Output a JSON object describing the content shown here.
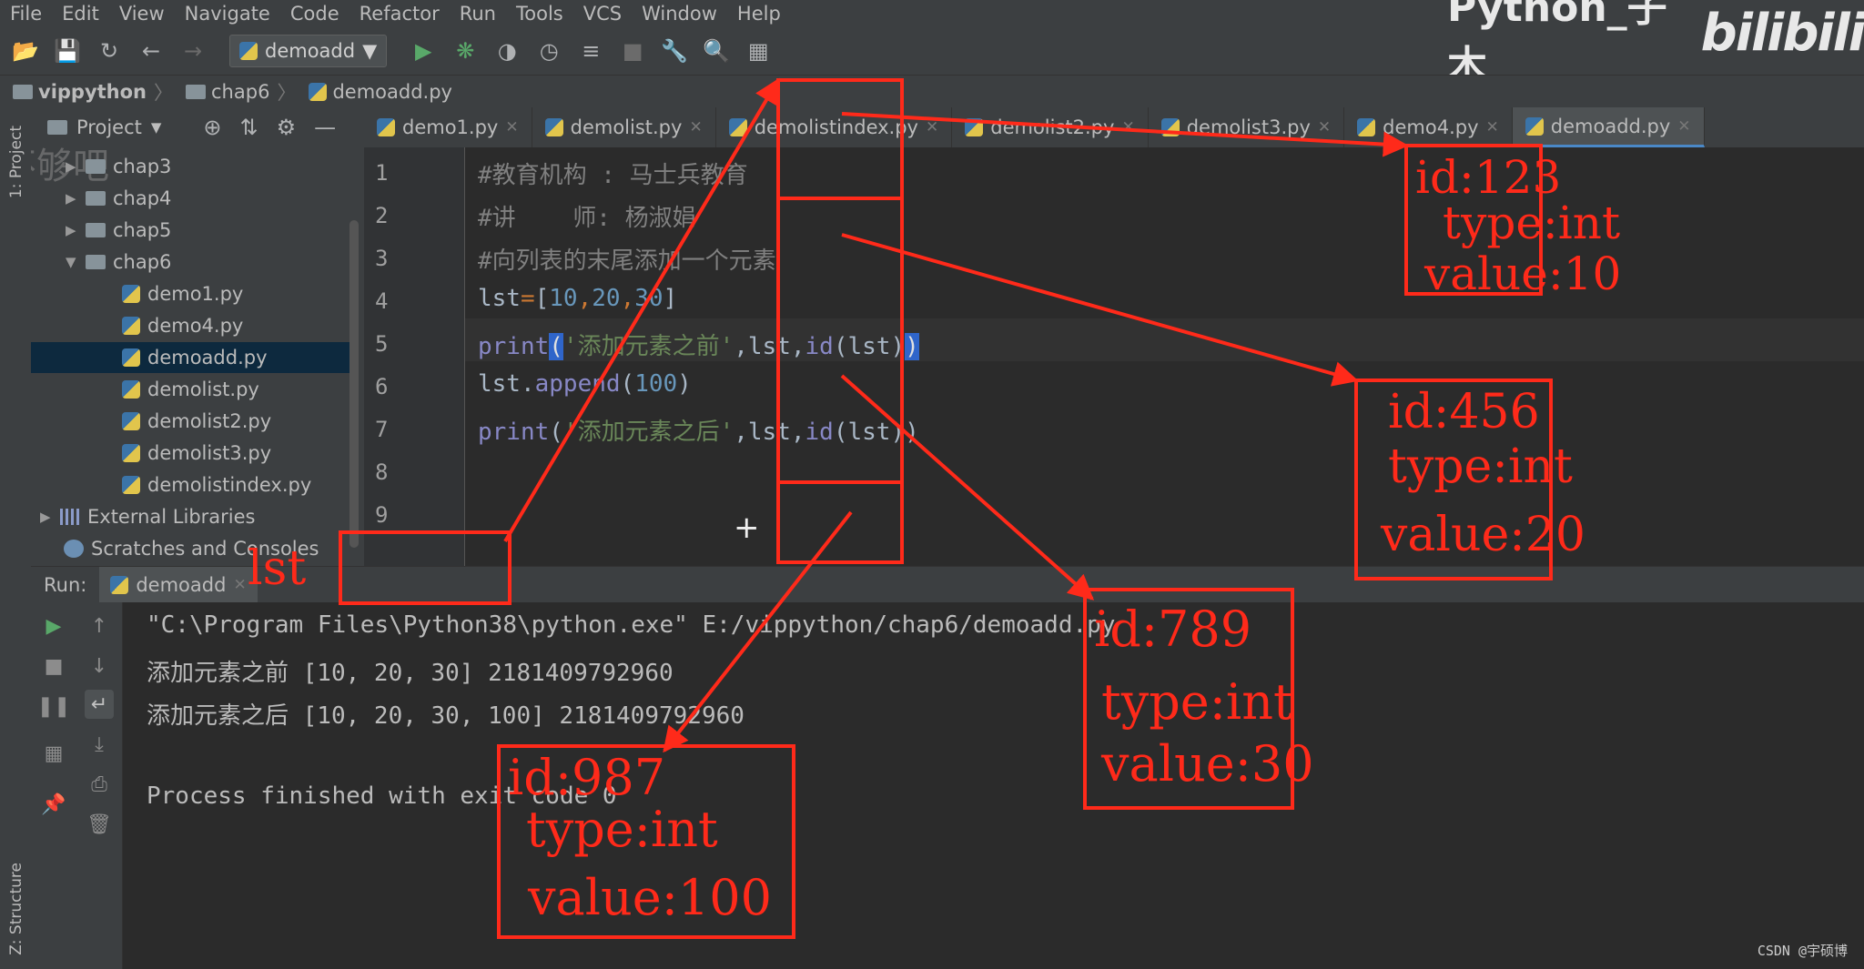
{
  "menu": [
    "File",
    "Edit",
    "View",
    "Navigate",
    "Code",
    "Refactor",
    "Run",
    "Tools",
    "VCS",
    "Window",
    "Help"
  ],
  "watermark": {
    "channel": "Python_子木",
    "logo": "bilibili"
  },
  "toolbar": {
    "run_config": "demoadd"
  },
  "breadcrumb": [
    "vippython",
    "chap6",
    "demoadd.py"
  ],
  "sidebar": {
    "project_label": "1: Project",
    "structure_label": "Z: Structure"
  },
  "project": {
    "header": "Project",
    "overlay": "不够吧",
    "tree": [
      {
        "label": "chap3",
        "type": "folder",
        "expanded": false
      },
      {
        "label": "chap4",
        "type": "folder",
        "expanded": false
      },
      {
        "label": "chap5",
        "type": "folder",
        "expanded": false
      },
      {
        "label": "chap6",
        "type": "folder",
        "expanded": true
      },
      {
        "label": "demo1.py",
        "type": "py"
      },
      {
        "label": "demo4.py",
        "type": "py"
      },
      {
        "label": "demoadd.py",
        "type": "py",
        "selected": true
      },
      {
        "label": "demolist.py",
        "type": "py"
      },
      {
        "label": "demolist2.py",
        "type": "py"
      },
      {
        "label": "demolist3.py",
        "type": "py"
      },
      {
        "label": "demolistindex.py",
        "type": "py"
      },
      {
        "label": "External Libraries",
        "type": "lib"
      },
      {
        "label": "Scratches and Consoles",
        "type": "scratch"
      }
    ]
  },
  "tabs": [
    {
      "label": "demo1.py"
    },
    {
      "label": "demolist.py"
    },
    {
      "label": "demolistindex.py"
    },
    {
      "label": "demolist2.py"
    },
    {
      "label": "demolist3.py"
    },
    {
      "label": "demo4.py"
    },
    {
      "label": "demoadd.py",
      "active": true
    }
  ],
  "editor": {
    "line_numbers": [
      "1",
      "2",
      "3",
      "4",
      "5",
      "6",
      "7",
      "8",
      "9"
    ],
    "line1": "#教育机构 : 马士兵教育",
    "line2": "#讲    师: 杨淑娟",
    "line3": "#向列表的末尾添加一个元素",
    "line4": {
      "a": "lst",
      "b": "=",
      "c": "[",
      "d": "10",
      "e": ",",
      "f": "20",
      "g": ",",
      "h": "30",
      "i": "]"
    },
    "line5": {
      "fn": "print",
      "open": "(",
      "str": "'添加元素之前'",
      "sep": ",lst,",
      "fn2": "id",
      "inner": "(lst)",
      "close": ")"
    },
    "line6": {
      "a": "lst.",
      "b": "append",
      "c": "(",
      "d": "100",
      "e": ")"
    },
    "line7": {
      "fn": "print",
      "open": "(",
      "str": "'添加元素之后'",
      "sep": ",lst,",
      "fn2": "id",
      "inner": "(lst))"
    }
  },
  "run": {
    "label": "Run:",
    "tab": "demoadd",
    "lines": [
      "\"C:\\Program Files\\Python38\\python.exe\" E:/vippython/chap6/demoadd.py",
      "添加元素之前 [10, 20, 30] 2181409792960",
      "添加元素之后 [10, 20, 30, 100] 2181409792960",
      "",
      "Process finished with exit code 0"
    ]
  },
  "annotations": {
    "lst_label": "lst",
    "objects": [
      {
        "id": "id:123",
        "type": "type:int",
        "value": "value:10"
      },
      {
        "id": "id:456",
        "type": "type:int",
        "value": "value:20"
      },
      {
        "id": "id:789",
        "type": "type:int",
        "value": "value:30"
      },
      {
        "id": "id:987",
        "type": "type:int",
        "value": "value:100"
      }
    ],
    "color": "#ff2a1a"
  },
  "footer": "CSDN @宇硕博"
}
